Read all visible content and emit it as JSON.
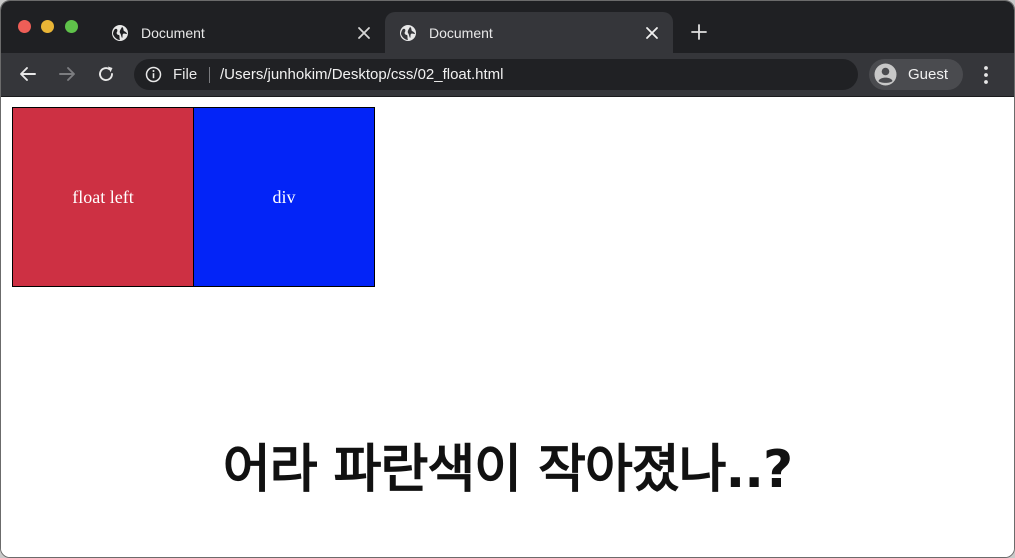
{
  "tabs": [
    {
      "title": "Document",
      "active": false
    },
    {
      "title": "Document",
      "active": true
    }
  ],
  "toolbar": {
    "scheme_label": "File",
    "url": "/Users/junhokim/Desktop/css/02_float.html",
    "profile_name": "Guest"
  },
  "page": {
    "float_box_text": "float left",
    "div_box_text": "div",
    "caption": "어라 파란색이 작아졌나..?"
  },
  "colors": {
    "float_box": "#cd3043",
    "div_box": "#0324f7",
    "tab_strip": "#1f2023",
    "toolbar": "#35363a"
  },
  "icons": [
    "globe-icon",
    "close-icon",
    "plus-icon",
    "back-arrow-icon",
    "forward-arrow-icon",
    "reload-icon",
    "info-icon",
    "profile-avatar-icon",
    "kebab-menu-icon"
  ]
}
